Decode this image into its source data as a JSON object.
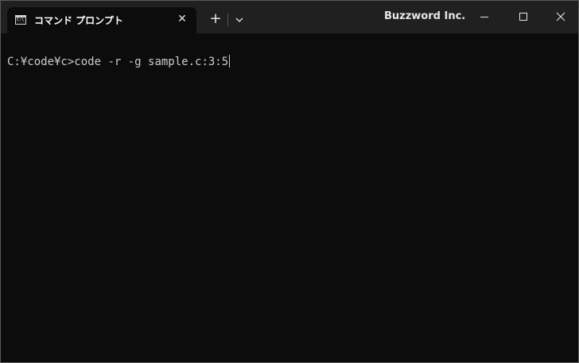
{
  "tab": {
    "title": "コマンド プロンプト",
    "icon": "cmd-icon",
    "close_glyph": "✕"
  },
  "titlebar": {
    "app_title": "Buzzword Inc.",
    "new_tab_glyph": "+",
    "dropdown_icon": "chevron-down-icon"
  },
  "window_controls": {
    "minimize_icon": "minimize-icon",
    "maximize_icon": "maximize-icon",
    "close_icon": "close-icon"
  },
  "terminal": {
    "prompt": "C:¥code¥c>",
    "command": "code -r -g sample.c:3:5",
    "foreground": "#cccccc",
    "background": "#0c0c0c"
  }
}
